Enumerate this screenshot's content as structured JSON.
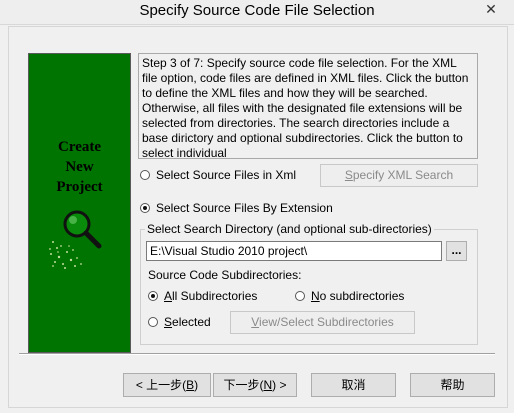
{
  "window": {
    "title": "Specify Source Code File Selection",
    "close_glyph": "✕"
  },
  "sidebar": {
    "title_lines": [
      "Create",
      "New",
      "Project"
    ],
    "icon": "magnifier-icon",
    "background": "#007400"
  },
  "description": "Step 3 of 7: Specify source code file selection. For the XML file option, code files are defined in XML files. Click the button to define the XML files and how they will be searched. Otherwise, all files with the designated file extensions will be selected from directories. The search directories include a base dirictory and optional subdirectories. Click the button to select individual",
  "source_mode": {
    "xml_option": "Select Source Files in Xml",
    "xml_checked": false,
    "specify_xml_button_prefix": "",
    "specify_xml_button_mnemonic": "S",
    "specify_xml_button_rest": "pecify XML Search",
    "extension_option": "Select Source Files By Extension",
    "extension_checked": true
  },
  "search_group": {
    "legend": "Select Search Directory (and optional sub-directories)",
    "path_value": "E:\\Visual Studio 2010 project\\",
    "browse_label": "...",
    "subdirs_label": "Source Code Subdirectories:",
    "all_prefix": "",
    "all_mnemonic": "A",
    "all_rest": "ll Subdirectories",
    "all_checked": true,
    "none_prefix": "",
    "none_mnemonic": "N",
    "none_rest": "o subdirectories",
    "none_checked": false,
    "selected_prefix": "",
    "selected_mnemonic": "S",
    "selected_rest": "elected",
    "selected_checked": false,
    "view_select_prefix": "",
    "view_select_mnemonic": "V",
    "view_select_rest": "iew/Select Subdirectories"
  },
  "footer": {
    "back_prefix": "< 上一步(",
    "back_mnemonic": "B",
    "back_suffix": ")",
    "next_prefix": "下一步(",
    "next_mnemonic": "N",
    "next_suffix": ") >",
    "cancel": "取消",
    "help": "帮助"
  }
}
